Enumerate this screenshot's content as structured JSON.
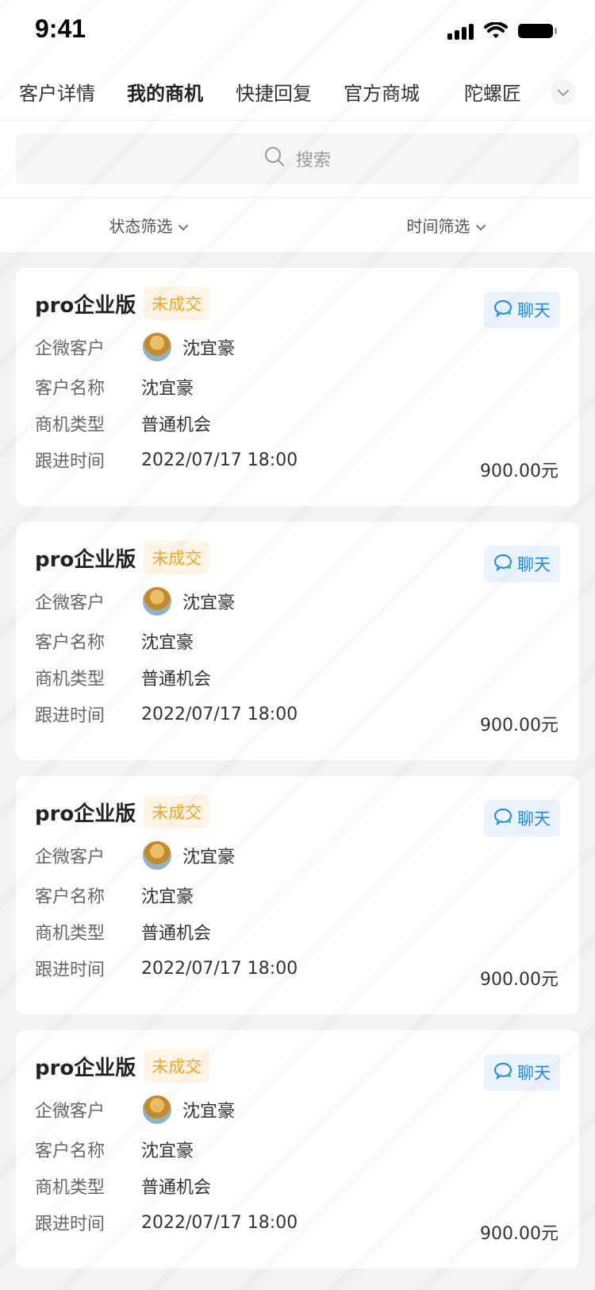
{
  "status_bar": {
    "time": "9:41"
  },
  "tabs": [
    {
      "label": "客户详情",
      "active": false
    },
    {
      "label": "我的商机",
      "active": true
    },
    {
      "label": "快捷回复",
      "active": false
    },
    {
      "label": "官方商城",
      "active": false
    },
    {
      "label": "陀螺匠",
      "active": false
    }
  ],
  "search": {
    "placeholder": "搜索"
  },
  "filters": [
    {
      "label": "状态筛选"
    },
    {
      "label": "时间筛选"
    }
  ],
  "labels": {
    "qiwei_customer": "企微客户",
    "customer_name": "客户名称",
    "opportunity_type": "商机类型",
    "follow_time": "跟进时间",
    "chat": "聊天"
  },
  "cards": [
    {
      "title": "pro企业版",
      "status": "未成交",
      "qiwei_customer": "沈宜豪",
      "customer_name": "沈宜豪",
      "opportunity_type": "普通机会",
      "follow_time": "2022/07/17 18:00",
      "amount": "900.00元"
    },
    {
      "title": "pro企业版",
      "status": "未成交",
      "qiwei_customer": "沈宜豪",
      "customer_name": "沈宜豪",
      "opportunity_type": "普通机会",
      "follow_time": "2022/07/17 18:00",
      "amount": "900.00元"
    },
    {
      "title": "pro企业版",
      "status": "未成交",
      "qiwei_customer": "沈宜豪",
      "customer_name": "沈宜豪",
      "opportunity_type": "普通机会",
      "follow_time": "2022/07/17 18:00",
      "amount": "900.00元"
    },
    {
      "title": "pro企业版",
      "status": "未成交",
      "qiwei_customer": "沈宜豪",
      "customer_name": "沈宜豪",
      "opportunity_type": "普通机会",
      "follow_time": "2022/07/17 18:00",
      "amount": "900.00元"
    }
  ],
  "colors": {
    "accent_blue": "#1E88E5",
    "tag_orange": "#F5A623",
    "background": "#F2F3F5"
  }
}
